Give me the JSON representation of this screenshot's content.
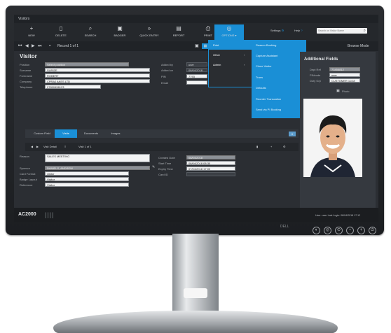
{
  "app": {
    "title": "Visitors",
    "toolbar": [
      {
        "icon": "plus-icon",
        "glyph": "+",
        "label": "NEW"
      },
      {
        "icon": "trash-icon",
        "glyph": "🗑",
        "label": "DELETE"
      },
      {
        "icon": "search-icon",
        "glyph": "⌕",
        "label": "SEARCH"
      },
      {
        "icon": "badge-icon",
        "glyph": "▣",
        "label": "BADGER"
      },
      {
        "icon": "forward-icon",
        "glyph": "»",
        "label": "QUICK ENTRY"
      },
      {
        "icon": "report-icon",
        "glyph": "▤",
        "label": "REPORT"
      },
      {
        "icon": "print-icon",
        "glyph": "⎙",
        "label": "PRINT"
      },
      {
        "icon": "options-icon",
        "glyph": "◎",
        "label": "OPTIONS ▾"
      }
    ],
    "settings_label": "Settings",
    "help_label": "Help",
    "search_placeholder": "Search on Visitor Name",
    "record_label": "Record 1 of 1",
    "browse_label": "Browse Mode"
  },
  "visitor": {
    "heading": "Visitor",
    "fields": [
      {
        "label": "Position",
        "value": "Select position",
        "style": "grey"
      },
      {
        "label": "Surname",
        "value": "SURIZE",
        "style": "light"
      },
      {
        "label": "Forename",
        "value": "ROBERT",
        "style": "light"
      },
      {
        "label": "Company",
        "value": "CPRAJ AKES LTD",
        "style": "light"
      },
      {
        "label": "Telephone",
        "value": "07890456123",
        "style": "light"
      }
    ],
    "right_fields": [
      {
        "label": "Added by",
        "value": "user"
      },
      {
        "label": "Added on",
        "value": "08/04/2018"
      },
      {
        "label": "PIN",
        "value": "7793"
      },
      {
        "label": "Email",
        "value": ""
      }
    ]
  },
  "menus": {
    "level1": [
      "Print",
      "Other",
      "Admin"
    ],
    "level2": [
      "Reason Booking",
      "Capture Assistant",
      "Clone Visitor",
      "Trans",
      "Defaults",
      "Reorder Transcation",
      "Send via PI Booking"
    ]
  },
  "additional": {
    "heading": "Additional Fields",
    "fields": [
      {
        "label": "Dept Ref",
        "value": "73456812"
      },
      {
        "label": "PINcode",
        "value": "user"
      },
      {
        "label": "Duty Grp",
        "value": "CUSTOMER 11/18"
      }
    ],
    "photo_label": "Photo"
  },
  "tabs": [
    "Custom Field",
    "Visits",
    "Documents",
    "Images"
  ],
  "visit": {
    "nav_label": "Visit Detail",
    "record_label": "Visit 1 of 1",
    "fields_left": [
      {
        "label": "Reason",
        "value": "SALES MEETING"
      },
      {
        "label": "Sponsor",
        "value": "DANIELS, ANDREW"
      },
      {
        "label": "Card Format",
        "value": "visitor"
      },
      {
        "label": "Badge Layout",
        "value": "Visitor"
      },
      {
        "label": "Reference",
        "value": "Visitor"
      }
    ],
    "fields_right": [
      {
        "label": "Created Date",
        "value": "08/04/2018"
      },
      {
        "label": "Start Time",
        "value": "08/04/2018 08:30"
      },
      {
        "label": "Expiry Time",
        "value": "07/04/2018 17:00"
      },
      {
        "label": "Card ID",
        "value": ""
      }
    ]
  },
  "status": {
    "brand": "AC2000",
    "right": "User: user   Last Login: 08/04/2018 17:12"
  },
  "monitor": {
    "brand": "DELL"
  }
}
